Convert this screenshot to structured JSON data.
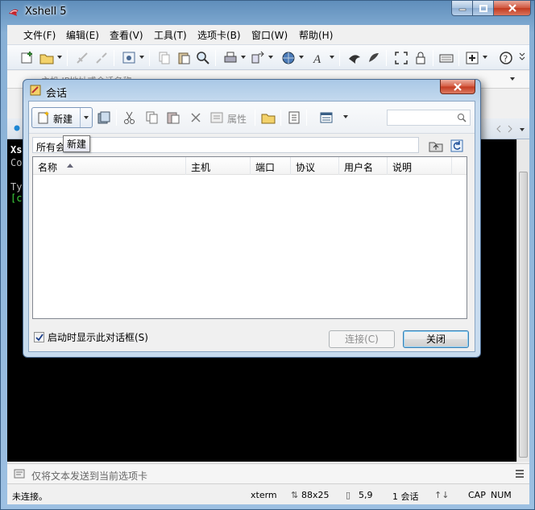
{
  "window": {
    "title": "Xshell 5"
  },
  "menu": [
    "文件(F)",
    "编辑(E)",
    "查看(V)",
    "工具(T)",
    "选项卡(B)",
    "窗口(W)",
    "帮助(H)"
  ],
  "address_bar": {
    "placeholder": "主机,IP地址或会话名称"
  },
  "terminal": {
    "lines": [
      "Xs",
      "Co",
      "",
      "Ty",
      "[c"
    ]
  },
  "send_bar": {
    "text": "仅将文本发送到当前选项卡"
  },
  "status_bar": {
    "connection": "未连接。",
    "terminal_type": "xterm",
    "size": "88x25",
    "cursor": "5,9",
    "sessions": "1 会话",
    "caps": "CAP",
    "num": "NUM"
  },
  "dialog": {
    "title": "会话",
    "toolbar": {
      "new_label": "新建",
      "properties_label": "属性"
    },
    "tooltip": "新建",
    "path": "所有会",
    "columns": [
      "名称",
      "主机",
      "端口",
      "协议",
      "用户名",
      "说明"
    ],
    "startup_checkbox": {
      "label": "启动时显示此对话框(S)",
      "checked": true
    },
    "connect_label": "连接(C)",
    "close_label": "关闭"
  },
  "colors": {
    "frame": "#88b0d6",
    "terminal_bg": "#000000",
    "close_red": "#c33b21"
  }
}
